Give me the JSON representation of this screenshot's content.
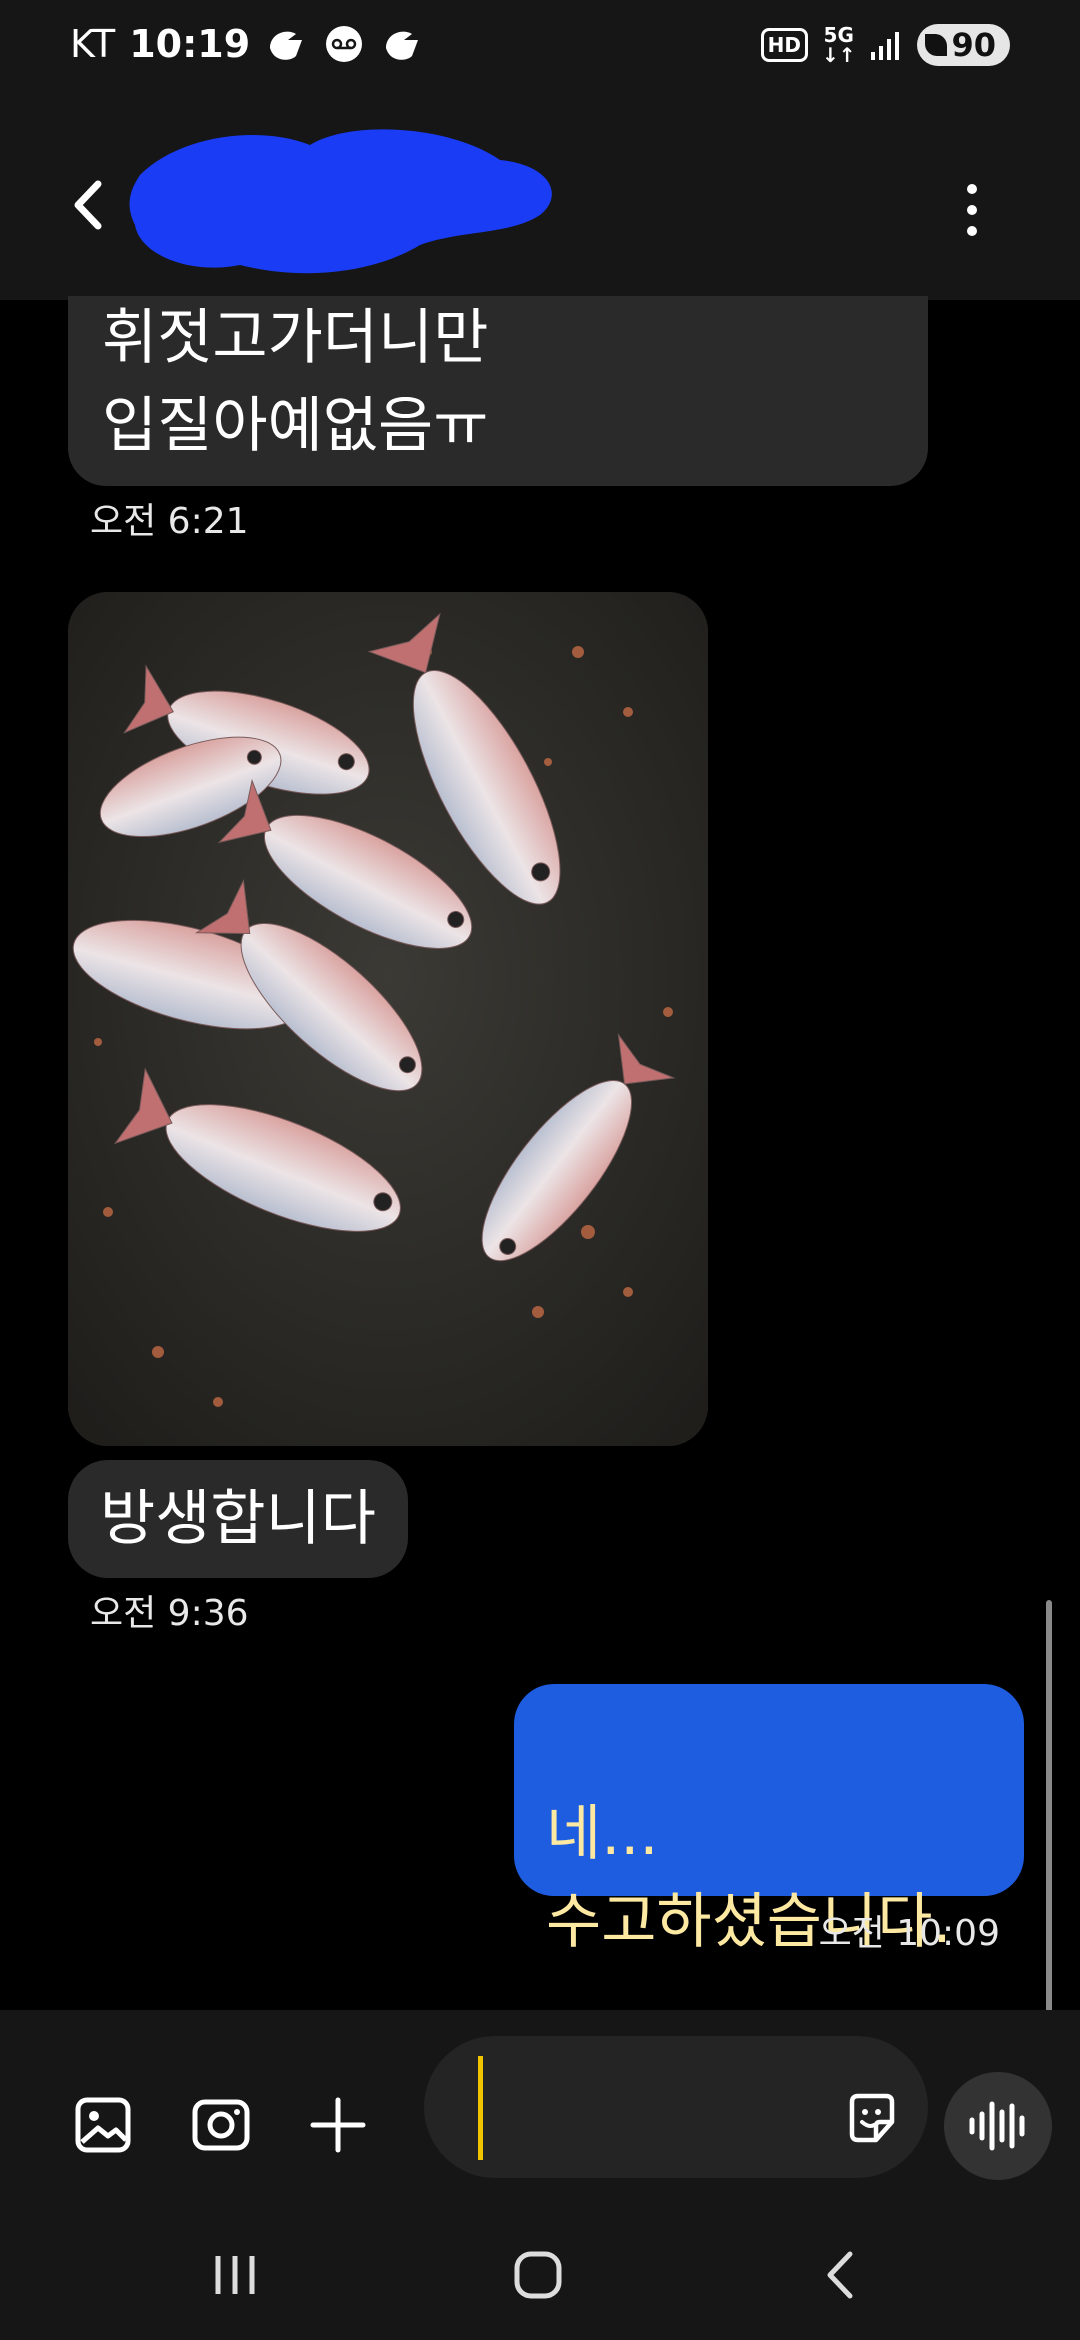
{
  "status_bar": {
    "carrier": "KT",
    "time": "10:19",
    "network_badge": "HD",
    "network_type": "5G",
    "battery": "90"
  },
  "header": {
    "contact_name": "",
    "back_icon": "chevron-left-icon",
    "more_icon": "vertical-dots-icon"
  },
  "messages": [
    {
      "direction": "incoming",
      "text": "휘젓고가더니만\n입질아예없음ㅠ",
      "time": "오전 6:21"
    },
    {
      "direction": "incoming",
      "type": "image"
    },
    {
      "direction": "incoming",
      "text": "방생합니다",
      "time": "오전 9:36"
    },
    {
      "direction": "outgoing",
      "text": "네...\n수고하셨습니다.",
      "time": "오전 10:09"
    }
  ],
  "composer": {
    "input_value": "",
    "tools": [
      "gallery-icon",
      "camera-icon",
      "plus-icon"
    ],
    "sticker_icon": "sticker-icon",
    "voice_icon": "voice-wave-icon"
  },
  "colors": {
    "background": "#000000",
    "bar": "#161616",
    "incoming_bubble": "#2a2a2a",
    "outgoing_bubble": "#1e5ce0",
    "outgoing_text": "#fde9a2",
    "cursor": "#f0c400"
  }
}
